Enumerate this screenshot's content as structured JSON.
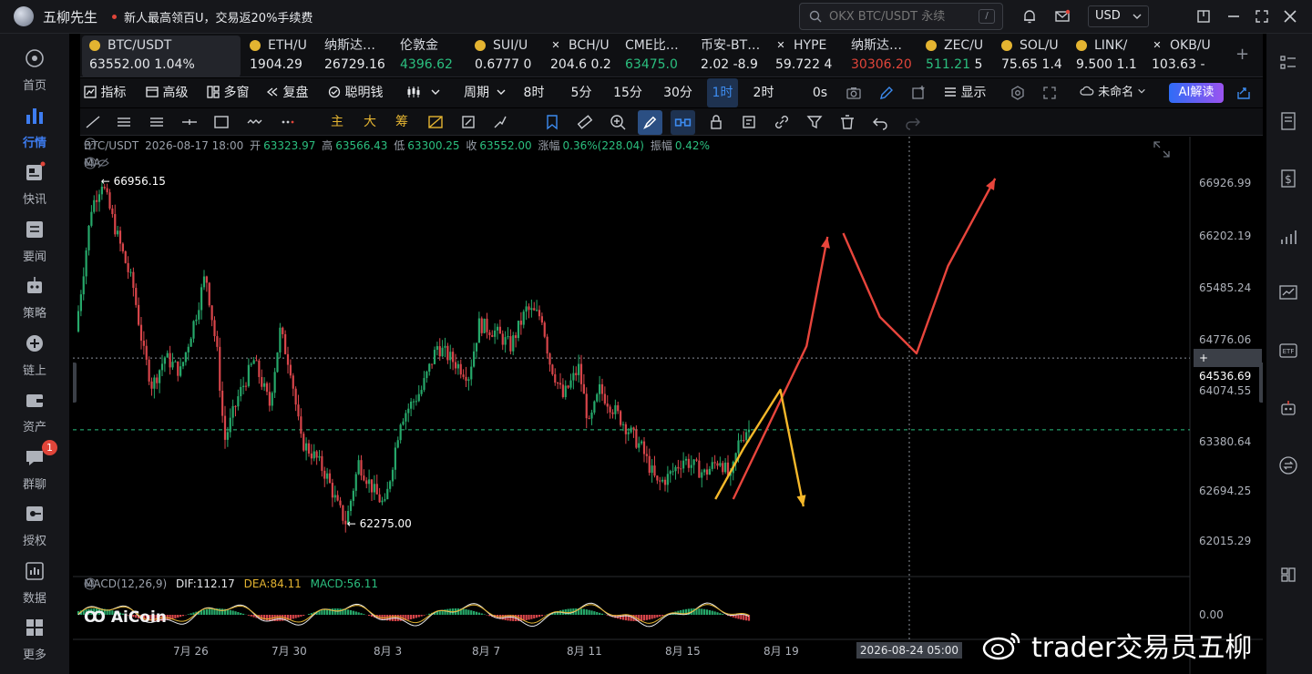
{
  "app": {
    "name": "五柳先生",
    "promo": "新人最高领百U，交易返20%手续费",
    "search_placeholder": "OKX BTC/USDT 永续",
    "search_key": "/",
    "currency": "USD"
  },
  "sidebar": [
    {
      "label": "首页",
      "icon": "home-icon"
    },
    {
      "label": "行情",
      "icon": "market-chart-icon",
      "active": true
    },
    {
      "label": "快讯",
      "icon": "flash-news-icon"
    },
    {
      "label": "要闻",
      "icon": "news-icon"
    },
    {
      "label": "策略",
      "icon": "strategy-robot-icon"
    },
    {
      "label": "链上",
      "icon": "onchain-icon"
    },
    {
      "label": "资产",
      "icon": "wallet-icon"
    },
    {
      "label": "群聊",
      "icon": "chat-icon",
      "badge": "1"
    },
    {
      "label": "授权",
      "icon": "authorize-icon"
    },
    {
      "label": "数据",
      "icon": "data-icon"
    },
    {
      "label": "更多",
      "icon": "more-grid-icon"
    }
  ],
  "tickers": [
    {
      "name": "BTC/USDT",
      "price": "63552.00",
      "change": "1.04%",
      "price_color": "#e6e8eb",
      "icon": "coin",
      "active": true
    },
    {
      "name": "ETH/U",
      "price": "1904.29",
      "change": "",
      "price_color": "#e6e8eb",
      "icon": "coin"
    },
    {
      "name": "纳斯达…",
      "price": "26729.16",
      "change": "",
      "price_color": "#e6e8eb",
      "icon": "none"
    },
    {
      "name": "伦敦金",
      "price": "4396.62",
      "change": "",
      "price_color": "#2bbf7f",
      "icon": "none"
    },
    {
      "name": "SUI/U",
      "price": "0.6777",
      "change": "0",
      "price_color": "#e6e8eb",
      "icon": "coin"
    },
    {
      "name": "BCH/U",
      "price": "204.6",
      "change": "0.2",
      "price_color": "#e6e8eb",
      "icon": "x"
    },
    {
      "name": "CME比…",
      "price": "63475.0",
      "change": "",
      "price_color": "#2bbf7f",
      "icon": "none"
    },
    {
      "name": "币安-BT…",
      "price": "2.02",
      "change": "-8.9",
      "price_color": "#e6e8eb",
      "icon": "none"
    },
    {
      "name": "HYPE",
      "price": "59.722",
      "change": "4",
      "price_color": "#e6e8eb",
      "icon": "x"
    },
    {
      "name": "纳斯达…",
      "price": "30306.20",
      "change": "",
      "price_color": "#e0453a",
      "icon": "none"
    },
    {
      "name": "ZEC/U",
      "price": "511.21",
      "change": "5",
      "price_color": "#2bbf7f",
      "icon": "coin"
    },
    {
      "name": "SOL/U",
      "price": "75.65",
      "change": "1.4",
      "price_color": "#e6e8eb",
      "icon": "coin"
    },
    {
      "name": "LINK/",
      "price": "9.500",
      "change": "1.1",
      "price_color": "#e6e8eb",
      "icon": "coin"
    },
    {
      "name": "OKB/U",
      "price": "103.63",
      "change": "-",
      "price_color": "#e6e8eb",
      "icon": "x"
    }
  ],
  "toolbar": {
    "indicator": "指标",
    "advanced": "高级",
    "multi_window": "多窗",
    "replay": "复盘",
    "smart_money": "聪明钱",
    "period": "周期",
    "intervals": [
      "8时",
      "5分",
      "15分",
      "30分",
      "1时",
      "2时",
      "0s"
    ],
    "active_interval": "1时",
    "display": "显示",
    "layout_name": "未命名",
    "ai_button": "AI解读"
  },
  "toolbar2": {
    "main": "主",
    "big": "大",
    "chips": "筹"
  },
  "chart_data": {
    "type": "candlestick",
    "symbol": "BTC/USDT",
    "timestamp": "2026-08-17 18:00",
    "ohlc_labels": {
      "open": "开",
      "high": "高",
      "low": "低",
      "close": "收",
      "change": "涨幅",
      "amplitude": "振幅"
    },
    "open": "63323.97",
    "high": "63566.43",
    "low": "63300.25",
    "close": "63552.00",
    "change": "0.36%(228.04)",
    "amplitude": "0.42%",
    "ma_label": "MA",
    "macd": {
      "label": "MACD(12,26,9)",
      "dif": "DIF:112.17",
      "dea": "DEA:84.11",
      "macd": "MACD:56.11",
      "zero": "0.00"
    },
    "y_ticks": [
      "66926.99",
      "66202.19",
      "65485.24",
      "64776.06",
      "64074.55",
      "63380.64",
      "62694.25",
      "62015.29"
    ],
    "ylim": [
      61700,
      67350
    ],
    "x_ticks": [
      "7月 26",
      "7月 30",
      "8月 3",
      "8月 7",
      "8月 11",
      "8月 15",
      "8月 19"
    ],
    "crosshair_price": "64536.69",
    "crosshair_time": "2026-08-24 05:00",
    "last_price": 63552.0,
    "period_high": "66956.15",
    "period_low": "62275.00",
    "price_path": [
      [
        0,
        64900
      ],
      [
        1.5,
        66600
      ],
      [
        2.5,
        66956
      ],
      [
        4,
        66200
      ],
      [
        5.5,
        65500
      ],
      [
        6.5,
        64600
      ],
      [
        7.3,
        64150
      ],
      [
        8.5,
        64550
      ],
      [
        10,
        64350
      ],
      [
        11.5,
        65150
      ],
      [
        12.4,
        65700
      ],
      [
        13.5,
        64600
      ],
      [
        14.2,
        63400
      ],
      [
        15.5,
        64000
      ],
      [
        17,
        64500
      ],
      [
        18.5,
        63900
      ],
      [
        19.5,
        64900
      ],
      [
        20.5,
        64400
      ],
      [
        21.5,
        63400
      ],
      [
        23,
        63150
      ],
      [
        24,
        62900
      ],
      [
        25,
        62500
      ],
      [
        25.8,
        62275
      ],
      [
        27,
        63100
      ],
      [
        28.5,
        62700
      ],
      [
        29.5,
        62500
      ],
      [
        31,
        63700
      ],
      [
        33,
        64100
      ],
      [
        34.5,
        64700
      ],
      [
        36,
        64500
      ],
      [
        37.5,
        64300
      ],
      [
        38.5,
        65000
      ],
      [
        40,
        64900
      ],
      [
        41.5,
        64700
      ],
      [
        43,
        65200
      ],
      [
        44.5,
        65100
      ],
      [
        45.2,
        64500
      ],
      [
        46.5,
        64000
      ],
      [
        48,
        64400
      ],
      [
        49,
        63600
      ],
      [
        50,
        64100
      ],
      [
        51.5,
        63800
      ],
      [
        53,
        63500
      ],
      [
        54,
        63300
      ],
      [
        55.5,
        62800
      ],
      [
        56.5,
        62900
      ],
      [
        58,
        63150
      ],
      [
        59,
        63050
      ],
      [
        60,
        62950
      ],
      [
        61.5,
        63150
      ],
      [
        62.5,
        62850
      ],
      [
        63.3,
        63400
      ],
      [
        64,
        63552
      ]
    ],
    "annotations": [
      {
        "type": "arrow",
        "color": "#e8453c",
        "points": [
          [
            62.5,
            62600
          ],
          [
            69.5,
            64700
          ],
          [
            71.5,
            66200
          ]
        ]
      },
      {
        "type": "arrow",
        "color": "#e8453c",
        "points": [
          [
            73,
            66250
          ],
          [
            76.5,
            65100
          ],
          [
            80,
            64600
          ],
          [
            83,
            65800
          ],
          [
            87.5,
            67000
          ]
        ]
      },
      {
        "type": "arrow",
        "color": "#f5b82a",
        "points": [
          [
            60.8,
            62600
          ],
          [
            63.5,
            63300
          ],
          [
            67,
            64100
          ],
          [
            69.2,
            62500
          ]
        ]
      }
    ]
  },
  "watermark": "trader交易员五柳"
}
